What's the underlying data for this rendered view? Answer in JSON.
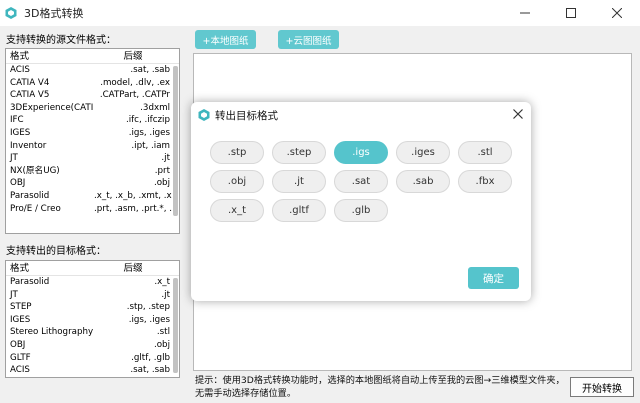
{
  "window": {
    "title": "3D格式转换",
    "accent": "#55c4cc"
  },
  "source": {
    "label": "支持转换的源文件格式：",
    "header": [
      "格式",
      "后缀"
    ],
    "rows": [
      [
        "ACIS",
        ".sat, .sab"
      ],
      [
        "CATIA V4",
        ".model, .dlv, .ex"
      ],
      [
        "CATIA V5",
        ".CATPart, .CATPr"
      ],
      [
        "3DExperience(CATI...",
        ".3dxml"
      ],
      [
        "IFC",
        ".ifc, .ifczip"
      ],
      [
        "IGES",
        ".igs, .iges"
      ],
      [
        "Inventor",
        ".ipt, .iam"
      ],
      [
        "JT",
        ".jt"
      ],
      [
        "NX(原名UG)",
        ".prt"
      ],
      [
        "OBJ",
        ".obj"
      ],
      [
        "Parasolid",
        ".x_t, .x_b, .xmt, .xm"
      ],
      [
        "Pro/E / Creo",
        ".prt, .asm, .prt.*, .as"
      ]
    ]
  },
  "target": {
    "label": "支持转出的目标格式：",
    "header": [
      "格式",
      "后缀"
    ],
    "rows": [
      [
        "Parasolid",
        ".x_t"
      ],
      [
        "JT",
        ".jt"
      ],
      [
        "STEP",
        ".stp, .step"
      ],
      [
        "IGES",
        ".igs, .iges"
      ],
      [
        "Stereo Lithography",
        ".stl"
      ],
      [
        "OBJ",
        ".obj"
      ],
      [
        "GLTF",
        ".gltf, .glb"
      ],
      [
        "ACIS",
        ".sat, .sab"
      ]
    ]
  },
  "toolbar": {
    "local_label": "+本地图纸",
    "cloud_label": "+云图图纸"
  },
  "hint": "提示：使用3D格式转换功能时，选择的本地图纸将自动上传至我的云图→三维模型文件夹，无需手动选择存储位置。",
  "start_label": "开始转换",
  "dialog": {
    "title": "转出目标格式",
    "ok_label": "确定",
    "selected": ".igs",
    "formats": [
      ".stp",
      ".step",
      ".igs",
      ".iges",
      ".stl",
      ".obj",
      ".jt",
      ".sat",
      ".sab",
      ".fbx",
      ".x_t",
      ".gltf",
      ".glb"
    ]
  },
  "icons": {
    "app": "app-logo-icon",
    "minimize": "minimize-icon",
    "maximize": "maximize-icon",
    "close": "close-icon"
  }
}
